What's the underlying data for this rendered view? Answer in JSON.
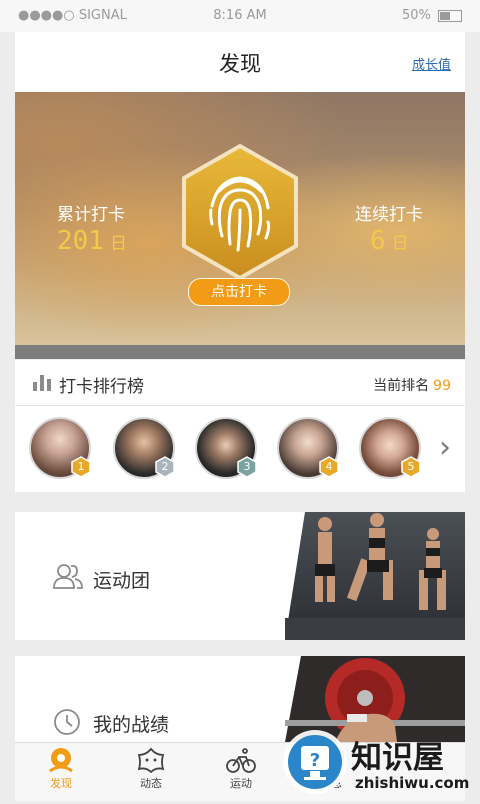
{
  "status_bar": {
    "carrier": "●●●●○ SIGNAL",
    "time": "8:16 AM",
    "battery": "50%"
  },
  "header": {
    "title": "发现",
    "right_link": "成长值"
  },
  "checkin": {
    "total_label": "累计打卡",
    "total_value": "201",
    "total_unit": "日",
    "streak_label": "连续打卡",
    "streak_value": "6",
    "streak_unit": "日",
    "button_label": "点击打卡"
  },
  "leaderboard": {
    "title": "打卡排行榜",
    "rank_label": "当前排名",
    "rank_value": "99",
    "avatars": [
      {
        "rank": "1"
      },
      {
        "rank": "2"
      },
      {
        "rank": "3"
      },
      {
        "rank": "4"
      },
      {
        "rank": "5"
      }
    ]
  },
  "cards": [
    {
      "label": "运动团",
      "icon": "group-icon"
    },
    {
      "label": "我的战绩",
      "icon": "clock-icon"
    }
  ],
  "tabbar": {
    "items": [
      {
        "label": "发现",
        "icon": "discover-icon",
        "active": true
      },
      {
        "label": "动态",
        "icon": "feed-icon",
        "active": false
      },
      {
        "label": "运动",
        "icon": "bike-icon",
        "active": false
      },
      {
        "label": "消息",
        "icon": "message-icon",
        "active": false
      }
    ]
  },
  "watermark": {
    "brand": "知识屋",
    "domain": "zhishiwu.com"
  },
  "colors": {
    "accent": "#f29b16",
    "link": "#2d6ab4",
    "gold": "#f5c84a"
  }
}
